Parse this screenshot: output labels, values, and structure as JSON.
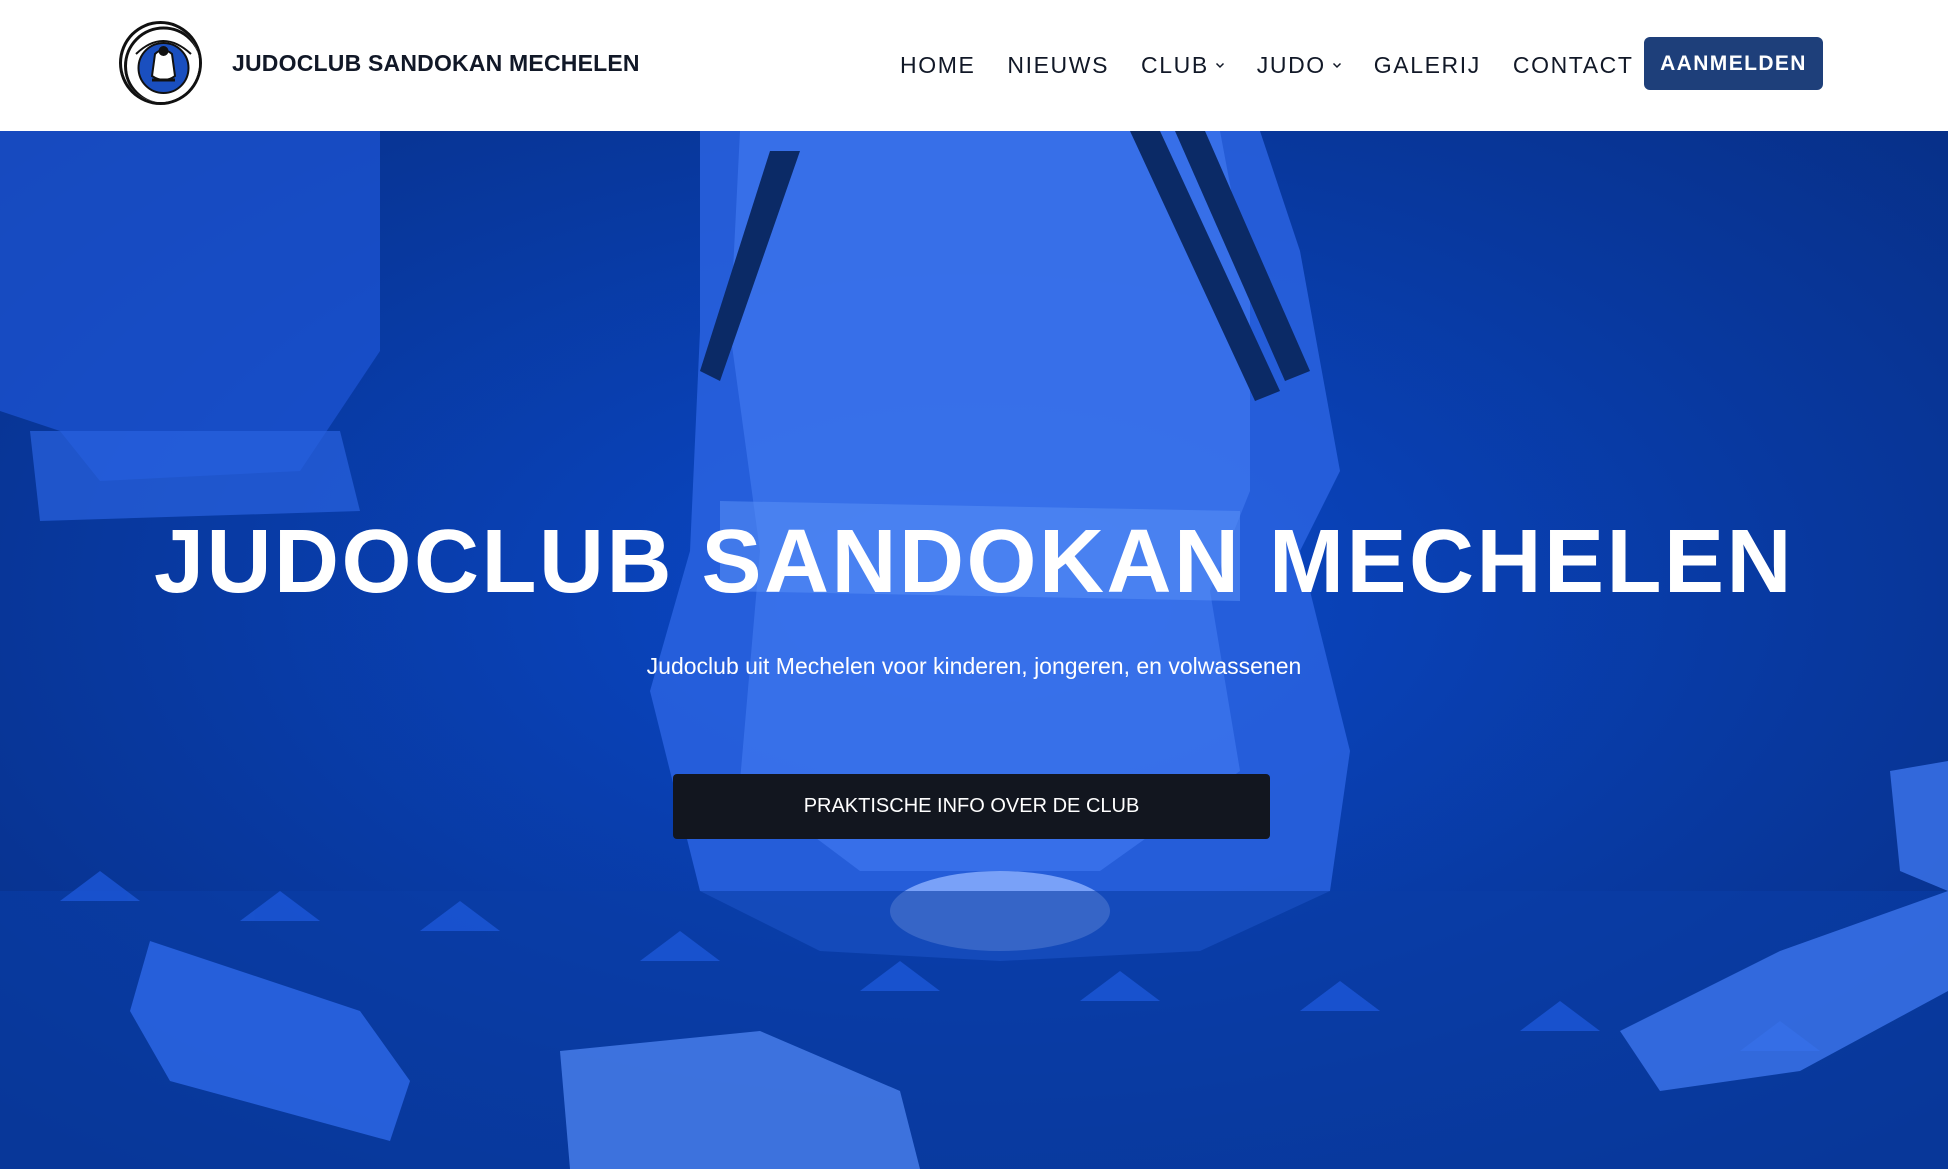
{
  "header": {
    "brand_name": "JUDOCLUB SANDOKAN MECHELEN",
    "logo_text": "SANDOKAN",
    "nav": [
      {
        "label": "HOME",
        "has_dropdown": false
      },
      {
        "label": "NIEUWS",
        "has_dropdown": false
      },
      {
        "label": "CLUB",
        "has_dropdown": true
      },
      {
        "label": "JUDO",
        "has_dropdown": true
      },
      {
        "label": "GALERIJ",
        "has_dropdown": false
      },
      {
        "label": "CONTACT",
        "has_dropdown": false
      }
    ],
    "cta_label": "AANMELDEN"
  },
  "hero": {
    "title": "JUDOCLUB SANDOKAN MECHELEN",
    "subtitle": "Judoclub uit Mechelen voor kinderen, jongeren, en volwassenen",
    "cta_label": "PRAKTISCHE INFO OVER DE CLUB"
  },
  "colors": {
    "header_bg": "#ffffff",
    "nav_text": "#111827",
    "cta_bg": "#1e3f7a",
    "hero_tint": "#0a3fb0",
    "hero_button_bg": "#12161f"
  }
}
